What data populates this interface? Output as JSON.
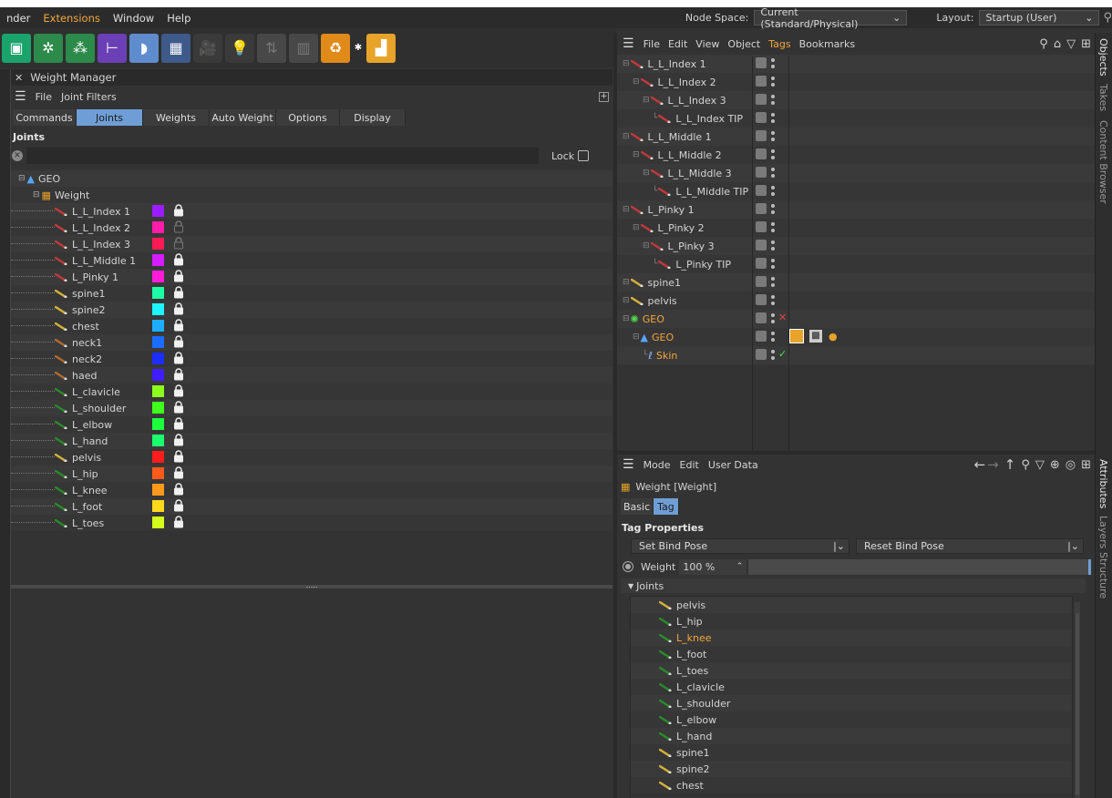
{
  "menubar": [
    "nder",
    "Extensions",
    "Window",
    "Help"
  ],
  "node_space": {
    "label": "Node Space:",
    "value": "Current (Standard/Physical)"
  },
  "layout": {
    "label": "Layout:",
    "value": "Startup (User)"
  },
  "weight_manager": {
    "title": "Weight Manager",
    "menu": [
      "File",
      "Joint Filters"
    ],
    "tabs": [
      "Commands",
      "Joints",
      "Weights",
      "Auto Weight",
      "Options",
      "Display"
    ],
    "active_tab": "Joints",
    "section": "Joints",
    "lock_label": "Lock",
    "tree_root": "GEO",
    "tree_tag": "Weight",
    "joints": [
      {
        "name": "L_L_Index 1",
        "color": "#9a1cff",
        "locked": true
      },
      {
        "name": "L_L_Index 2",
        "color": "#ff1ca8",
        "locked": false
      },
      {
        "name": "L_L_Index 3",
        "color": "#ff1a55",
        "locked": false
      },
      {
        "name": "L_L_Middle 1",
        "color": "#d51cff",
        "locked": true
      },
      {
        "name": "L_Pinky 1",
        "color": "#ff1cd9",
        "locked": true
      },
      {
        "name": "spine1",
        "color": "#1cffa6",
        "locked": true
      },
      {
        "name": "spine2",
        "color": "#1cf5ff",
        "locked": true
      },
      {
        "name": "chest",
        "color": "#1caeff",
        "locked": true
      },
      {
        "name": "neck1",
        "color": "#1c6bff",
        "locked": true
      },
      {
        "name": "neck2",
        "color": "#1c2eff",
        "locked": true
      },
      {
        "name": "haed",
        "color": "#401cff",
        "locked": true
      },
      {
        "name": "L_clavicle",
        "color": "#8cff1c",
        "locked": true
      },
      {
        "name": "L_shoulder",
        "color": "#41ff1c",
        "locked": true
      },
      {
        "name": "L_elbow",
        "color": "#1cff3d",
        "locked": true
      },
      {
        "name": "L_hand",
        "color": "#1cff6e",
        "locked": true
      },
      {
        "name": "pelvis",
        "color": "#ff1c1c",
        "locked": true
      },
      {
        "name": "L_hip",
        "color": "#ff5a1c",
        "locked": true
      },
      {
        "name": "L_knee",
        "color": "#ff991c",
        "locked": true
      },
      {
        "name": "L_foot",
        "color": "#ffd91c",
        "locked": true
      },
      {
        "name": "L_toes",
        "color": "#d2ff1c",
        "locked": true
      }
    ],
    "splitter": "....."
  },
  "object_manager": {
    "menu": [
      "File",
      "Edit",
      "View",
      "Object",
      "Tags",
      "Bookmarks"
    ],
    "rows": [
      {
        "name": "L_L_Index 1",
        "indent": 0
      },
      {
        "name": "L_L_Index 2",
        "indent": 1
      },
      {
        "name": "L_L_Index 3",
        "indent": 2
      },
      {
        "name": "L_L_Index TIP",
        "indent": 3
      },
      {
        "name": "L_L_Middle 1",
        "indent": 0
      },
      {
        "name": "L_L_Middle 2",
        "indent": 1
      },
      {
        "name": "L_L_Middle 3",
        "indent": 2
      },
      {
        "name": "L_L_Middle TIP",
        "indent": 3
      },
      {
        "name": "L_Pinky 1",
        "indent": 0
      },
      {
        "name": "L_Pinky 2",
        "indent": 1
      },
      {
        "name": "L_Pinky 3",
        "indent": 2
      },
      {
        "name": "L_Pinky TIP",
        "indent": 3
      },
      {
        "name": "spine1",
        "indent": 0
      },
      {
        "name": "pelvis",
        "indent": 0
      },
      {
        "name": "GEO",
        "indent": 0
      },
      {
        "name": "GEO",
        "indent": 1
      },
      {
        "name": "Skin",
        "indent": 2
      }
    ]
  },
  "attributes": {
    "menu": [
      "Mode",
      "Edit",
      "User Data"
    ],
    "object_title": "Weight [Weight]",
    "tabs": [
      "Basic",
      "Tag"
    ],
    "active_tab": "Tag",
    "section": "Tag Properties",
    "set_bind_pose": "Set Bind Pose",
    "reset_bind_pose": "Reset Bind Pose",
    "weight_label": "Weight",
    "weight_value": "100 %",
    "weight_fraction": 1.0,
    "joints_group": "Joints",
    "joint_list": [
      "pelvis",
      "L_hip",
      "L_knee",
      "L_foot",
      "L_toes",
      "L_clavicle",
      "L_shoulder",
      "L_elbow",
      "L_hand",
      "spine1",
      "spine2",
      "chest"
    ],
    "selected_joint": "L_knee"
  },
  "side_tabs_top": [
    "Objects",
    "Takes",
    "Content Browser"
  ],
  "side_tabs_bottom": [
    "Attributes",
    "Layers",
    "Structure"
  ],
  "colors": {
    "accent": "#6f9ed6",
    "orange": "#f3a73b",
    "bone_red": "#c0393b",
    "bone_green": "#2a8a2a",
    "bone_yellow": "#d4b03a",
    "bone_brown": "#b06a2e"
  }
}
